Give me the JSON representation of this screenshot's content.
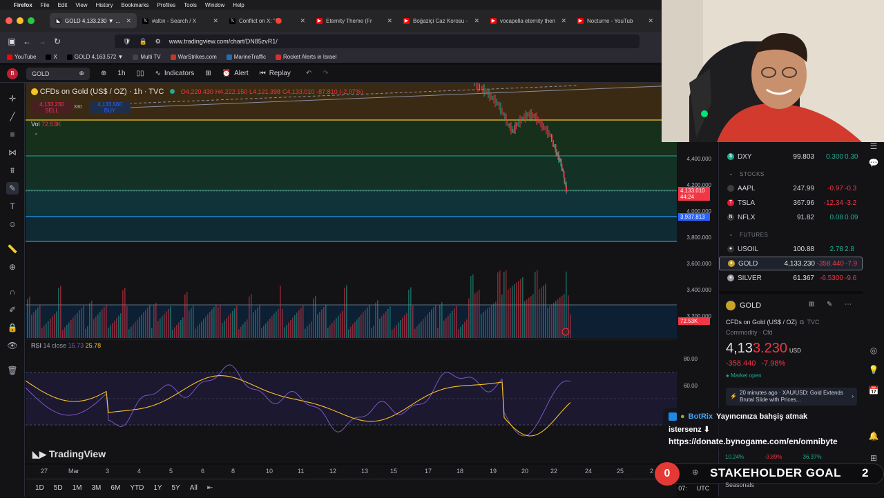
{
  "menubar": {
    "apple": "",
    "app": "Firefox",
    "items": [
      "File",
      "Edit",
      "View",
      "History",
      "Bookmarks",
      "Profiles",
      "Tools",
      "Window",
      "Help"
    ]
  },
  "tabs": [
    {
      "label": "GOLD 4,133.230 ▼ -7.9",
      "icon": "tradingview-icon",
      "color": "#2a2a30",
      "active": true
    },
    {
      "label": "#altın - Search / X",
      "icon": "x-logo-icon",
      "color": "#000000",
      "active": false
    },
    {
      "label": "Conflict on X: \"🔴",
      "icon": "x-logo-icon",
      "color": "#000000",
      "active": false
    },
    {
      "label": "Eternity Theme (Fr",
      "icon": "youtube-icon",
      "color": "#ff0000",
      "active": false
    },
    {
      "label": "Boğaziçi Caz Korosu - ",
      "icon": "youtube-icon",
      "color": "#ff0000",
      "active": false
    },
    {
      "label": "vocapella eternity then",
      "icon": "youtube-icon",
      "color": "#ff0000",
      "active": false
    },
    {
      "label": "Nocturne - YouTub",
      "icon": "youtube-icon",
      "color": "#ff0000",
      "active": false
    }
  ],
  "url": {
    "text": "www.tradingview.com/chart/DN85zvR1/"
  },
  "bookmarks": [
    {
      "label": "YouTube",
      "color": "#ff0000"
    },
    {
      "label": "X",
      "color": "#000000"
    },
    {
      "label": "GOLD 4,163.572 ▼",
      "color": "#000000"
    },
    {
      "label": "Multi TV",
      "color": "#444444"
    },
    {
      "label": "WarStrikes.com",
      "color": "#c0392b"
    },
    {
      "label": "MarineTraffic",
      "color": "#1f6fb2"
    },
    {
      "label": "Rocket Alerts in Israel",
      "color": "#d63031"
    }
  ],
  "toolbar": {
    "symbol": "GOLD",
    "interval": "1h",
    "indicators": "Indicators",
    "alert": "Alert",
    "replay": "Replay"
  },
  "legend": {
    "title": "CFDs on Gold (US$ / OZ) · 1h · TVC",
    "open": "O4,220.430",
    "high": "H4,222.150",
    "low": "L4,121.398",
    "close": "C4,133.010",
    "change": "-87.810 (-2.07%)",
    "sell_price": "4,133.230",
    "sell_label": "SELL",
    "spread": "330",
    "buy_price": "4,133.560",
    "buy_label": "BUY",
    "vol_label": "Vol",
    "vol_value": "72.53K",
    "rsi_label": "RSI",
    "rsi_params": "14 close",
    "rsi_value1": "15.73",
    "rsi_value2": "25.78"
  },
  "price_axis": {
    "labels": [
      "4,400.000",
      "4,200.000",
      "4,000.000",
      "3,800.000",
      "3,600.000",
      "3,400.000",
      "3,200.000"
    ],
    "current_price": "4,133.010",
    "countdown": "44:24",
    "blue_line": "3,937.813",
    "volume_tag": "72.53K",
    "rsi_labels": [
      "80.00",
      "60.00"
    ]
  },
  "time_axis": {
    "labels": [
      "27",
      "Mar",
      "3",
      "4",
      "5",
      "6",
      "8",
      "10",
      "11",
      "12",
      "13",
      "15",
      "17",
      "18",
      "19",
      "20",
      "22",
      "24",
      "25",
      "2"
    ]
  },
  "ranges": [
    "1D",
    "5D",
    "1M",
    "3M",
    "6M",
    "YTD",
    "1Y",
    "5Y",
    "All"
  ],
  "bottom_right": {
    "time": "07:",
    "tz": "UTC",
    "eth": "ETH"
  },
  "watermark": "TradingView",
  "watchlist": {
    "vix_row": {
      "sym": "VIX",
      "last": "20.78",
      "chg": "2.72",
      "pct": "+15"
    },
    "rows_top": [
      {
        "sym": "DXY",
        "last": "99.803",
        "chg": "0.300",
        "pct": "0.30",
        "color": "#22ab94",
        "icon": "$"
      }
    ],
    "stocks_head": "STOCKS",
    "stocks": [
      {
        "sym": "AAPL",
        "last": "247.99",
        "chg": "-0.97",
        "pct": "-0.3",
        "color": "#3d3d3d",
        "icon": ""
      },
      {
        "sym": "TSLA",
        "last": "367.96",
        "chg": "-12.34",
        "pct": "-3.2",
        "color": "#e31937",
        "icon": "T"
      },
      {
        "sym": "NFLX",
        "last": "91.82",
        "chg": "0.08",
        "pct": "0.09",
        "color": "#3d3d3d",
        "icon": "N"
      }
    ],
    "futures_head": "FUTURES",
    "futures": [
      {
        "sym": "USOIL",
        "last": "100.88",
        "chg": "2.78",
        "pct": "2.8",
        "color": "#333333",
        "icon": "●"
      },
      {
        "sym": "GOLD",
        "last": "4,133.230",
        "chg": "-358.440",
        "pct": "-7.9",
        "color": "#c9a227",
        "icon": "●"
      },
      {
        "sym": "SILVER",
        "last": "61.367",
        "chg": "-6.5300",
        "pct": "-9.6",
        "color": "#9aa0a6",
        "icon": "●"
      }
    ]
  },
  "details": {
    "symbol": "GOLD",
    "name": "CFDs on Gold (US$ / OZ)",
    "exchange": "TVC",
    "category": "Commodity",
    "subcategory": "Cfd",
    "price_main": "4,13",
    "price_tail": "3.230",
    "currency": "USD",
    "change": "-358.440",
    "change_pct": "-7.98%",
    "market_status": "Market open",
    "news": "20 minutes ago · XAU/USD: Gold Extends Brutal Slide with Prices..."
  },
  "donate": {
    "user": "BotRix",
    "text1": "Yayıncınıza bahşiş atmak",
    "text2": "istersenz ⬇",
    "link": "https://donate.bynogame.com/en/omnibyte"
  },
  "goal": {
    "left_num": "0",
    "label": "STAKEHOLDER GOAL",
    "right_num": "2"
  },
  "behind_goal": {
    "a": "10.24%",
    "b": "-3.89%",
    "c": "36.37%",
    "d": "YTD",
    "e": "1Y",
    "seasonals": "Seasonals"
  },
  "colors": {
    "up": "#22ab94",
    "down": "#f23645",
    "accent": "#2962ff",
    "gold": "#f7c325"
  }
}
